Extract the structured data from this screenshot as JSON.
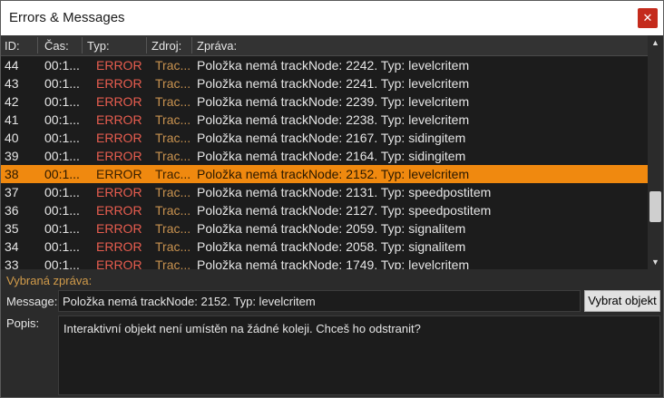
{
  "window": {
    "title": "Errors & Messages",
    "close_glyph": "✕",
    "close_color": "#c42b1c"
  },
  "table": {
    "columns": [
      "ID:",
      "Čas:",
      "Typ:",
      "Zdroj:",
      "Zpráva:"
    ],
    "rows": [
      {
        "id": "44",
        "time": "00:1...",
        "type": "ERROR",
        "source": "Trac...",
        "message": "Položka nemá trackNode: 2242. Typ: levelcritem"
      },
      {
        "id": "43",
        "time": "00:1...",
        "type": "ERROR",
        "source": "Trac...",
        "message": "Položka nemá trackNode: 2241. Typ: levelcritem"
      },
      {
        "id": "42",
        "time": "00:1...",
        "type": "ERROR",
        "source": "Trac...",
        "message": "Položka nemá trackNode: 2239. Typ: levelcritem"
      },
      {
        "id": "41",
        "time": "00:1...",
        "type": "ERROR",
        "source": "Trac...",
        "message": "Položka nemá trackNode: 2238. Typ: levelcritem"
      },
      {
        "id": "40",
        "time": "00:1...",
        "type": "ERROR",
        "source": "Trac...",
        "message": "Položka nemá trackNode: 2167. Typ: sidingitem"
      },
      {
        "id": "39",
        "time": "00:1...",
        "type": "ERROR",
        "source": "Trac...",
        "message": "Položka nemá trackNode: 2164. Typ: sidingitem"
      },
      {
        "id": "38",
        "time": "00:1...",
        "type": "ERROR",
        "source": "Trac...",
        "message": "Položka nemá trackNode: 2152. Typ: levelcritem",
        "selected": true
      },
      {
        "id": "37",
        "time": "00:1...",
        "type": "ERROR",
        "source": "Trac...",
        "message": "Položka nemá trackNode: 2131. Typ: speedpostitem"
      },
      {
        "id": "36",
        "time": "00:1...",
        "type": "ERROR",
        "source": "Trac...",
        "message": "Položka nemá trackNode: 2127. Typ: speedpostitem"
      },
      {
        "id": "35",
        "time": "00:1...",
        "type": "ERROR",
        "source": "Trac...",
        "message": "Položka nemá trackNode: 2059. Typ: signalitem"
      },
      {
        "id": "34",
        "time": "00:1...",
        "type": "ERROR",
        "source": "Trac...",
        "message": "Položka nemá trackNode: 2058. Typ: signalitem"
      },
      {
        "id": "33",
        "time": "00:1...",
        "type": "ERROR",
        "source": "Trac...",
        "message": "Položka nemá trackNode: 1749. Typ: levelcritem"
      }
    ],
    "colors": {
      "error": "#e85d4f",
      "source": "#c8924f",
      "selected_row": "#f0890f"
    }
  },
  "scrollbar": {
    "up_glyph": "▲",
    "down_glyph": "▼"
  },
  "detail": {
    "selected_label": "Vybraná zpráva:",
    "message_label": "Message:",
    "message_value": "Položka nemá trackNode: 2152. Typ: levelcritem",
    "select_button": "Vybrat objekt",
    "description_label": "Popis:",
    "description_value": "Interaktivní objekt není umístěn na žádné koleji. Chceš ho odstranit?"
  }
}
